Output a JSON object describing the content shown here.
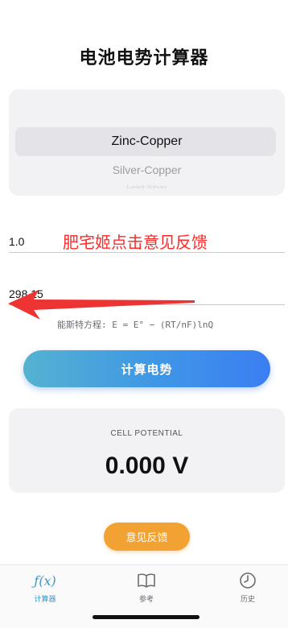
{
  "app": {
    "title": "电池电势计算器"
  },
  "picker": {
    "selected": "Zinc-Copper",
    "next": "Silver-Copper",
    "far": "Lead-Silver"
  },
  "inputs": {
    "concentration_value": "1.0",
    "temperature_value": "298.15"
  },
  "annotation": {
    "text": "肥宅姬点击意见反馈",
    "color": "#ff2a2a"
  },
  "formula": "能斯特方程: E = E° − (RT/nF)lnQ",
  "calculate_button": {
    "label": "计算电势"
  },
  "result": {
    "label": "CELL POTENTIAL",
    "value": "0.000 V"
  },
  "feedback_button": {
    "label": "意见反馈"
  },
  "tabbar": {
    "items": [
      {
        "label": "计算器",
        "icon": "function-icon",
        "active": true
      },
      {
        "label": "参考",
        "icon": "book-icon",
        "active": false
      },
      {
        "label": "历史",
        "icon": "clock-icon",
        "active": false
      }
    ]
  },
  "colors": {
    "accent": "#3a98c9",
    "gradient_start": "#54b2d1",
    "gradient_end": "#3b7ef3",
    "feedback": "#f2a233"
  }
}
